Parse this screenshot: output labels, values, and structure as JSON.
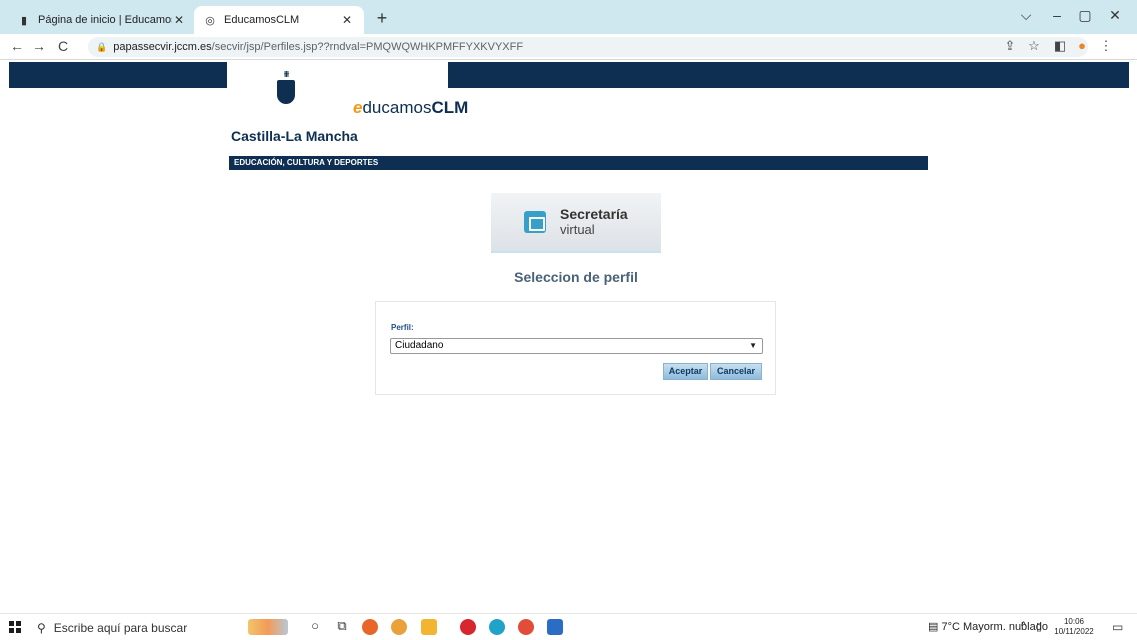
{
  "browser": {
    "tabs": [
      {
        "title": "Página de inicio | EducamosCLM",
        "active": false
      },
      {
        "title": "EducamosCLM",
        "active": true
      }
    ],
    "new_tab": "+",
    "window_controls": {
      "dropdown": "⌵",
      "minimize": "–",
      "maximize": "▢",
      "close": "✕"
    },
    "nav": {
      "back": "←",
      "forward": "→",
      "reload": "C"
    },
    "url_host": "papassecvir.jccm.es",
    "url_path": "/secvir/jsp/Perfiles.jsp??rndval=PMQWQWHKPMFFYXKVYXFF",
    "icons": [
      "share-icon",
      "star-icon",
      "sidebar-icon",
      "extension-icon",
      "menu-icon"
    ]
  },
  "page": {
    "region_name": "Castilla-La Mancha",
    "logo_text": {
      "e": "e",
      "ducamos": "ducamos",
      "clm": "CLM"
    },
    "department": "EDUCACIÓN, CULTURA Y DEPORTES",
    "secretaria": {
      "line1": "Secretaría",
      "line2": "virtual"
    },
    "selection_title": "Seleccion de perfil",
    "form": {
      "perfil_label": "Perfil:",
      "perfil_value": "Ciudadano",
      "accept_label": "Aceptar",
      "cancel_label": "Cancelar"
    }
  },
  "taskbar": {
    "search_placeholder": "Escribe aquí para buscar",
    "weather": "7°C  Mayorm. nublado",
    "time": "10:06",
    "date": "10/11/2022",
    "apps": [
      "file-explorer-icon",
      "paint-icon",
      "cortana-icon",
      "task-view-icon",
      "firefox-icon",
      "chrome-icon",
      "files-icon",
      "opera-icon",
      "edge-icon",
      "chrome-icon",
      "word-icon"
    ]
  },
  "colors": {
    "navy": "#0e2f52",
    "accent_orange": "#f39a1a",
    "tab_strip": "#cfe7ef",
    "button": "#8fbbdc"
  }
}
